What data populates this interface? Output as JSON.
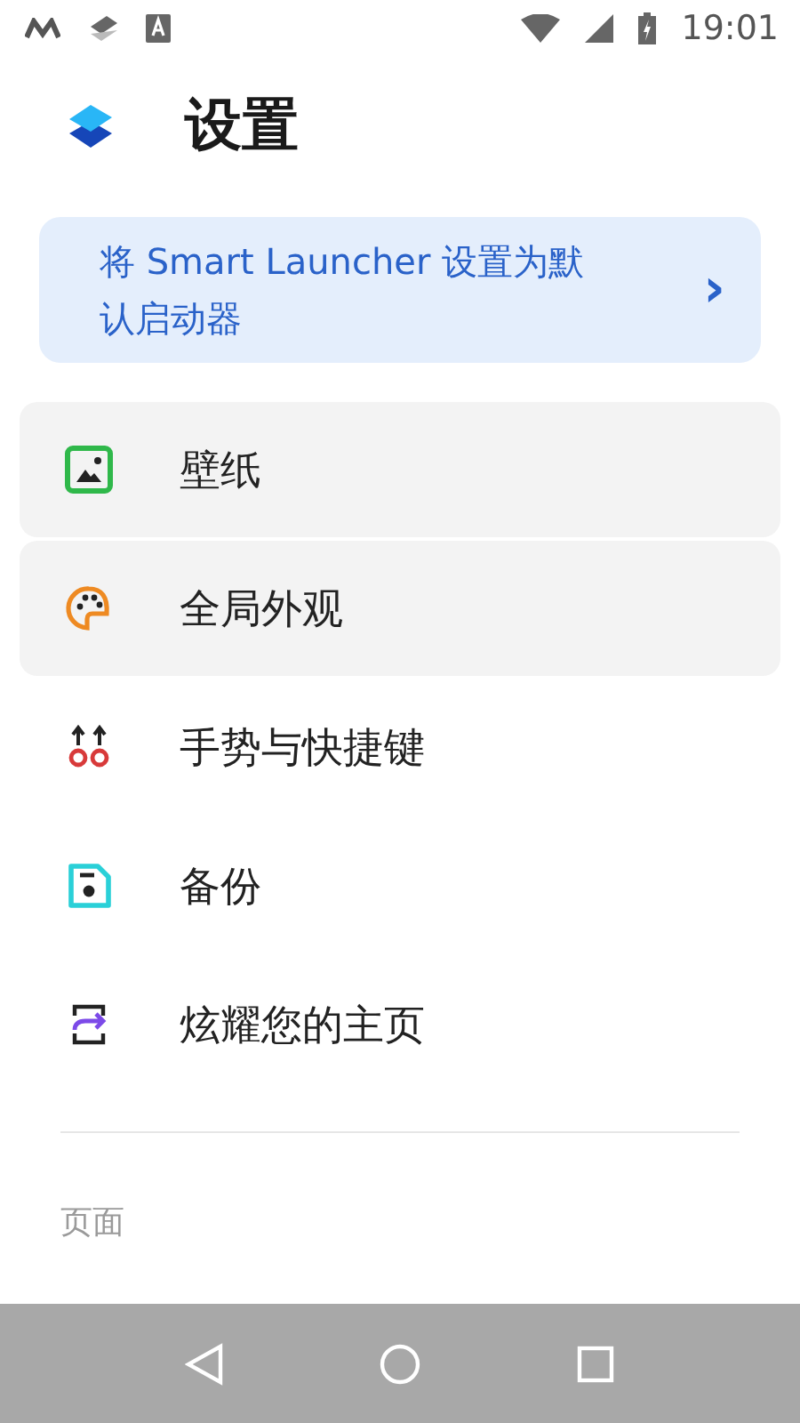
{
  "status_bar": {
    "time": "19:01"
  },
  "header": {
    "title": "设置"
  },
  "banner": {
    "text": "将 Smart Launcher 设置为默认启动器",
    "chevron": "›"
  },
  "menu": [
    {
      "kind": "wallpaper",
      "label": "壁纸",
      "highlighted": true
    },
    {
      "kind": "palette",
      "label": "全局外观",
      "highlighted": true
    },
    {
      "kind": "gestures",
      "label": "手势与快捷键",
      "highlighted": false
    },
    {
      "kind": "backup",
      "label": "备份",
      "highlighted": false
    },
    {
      "kind": "share",
      "label": "炫耀您的主页",
      "highlighted": false
    }
  ],
  "section": {
    "title": "页面"
  }
}
